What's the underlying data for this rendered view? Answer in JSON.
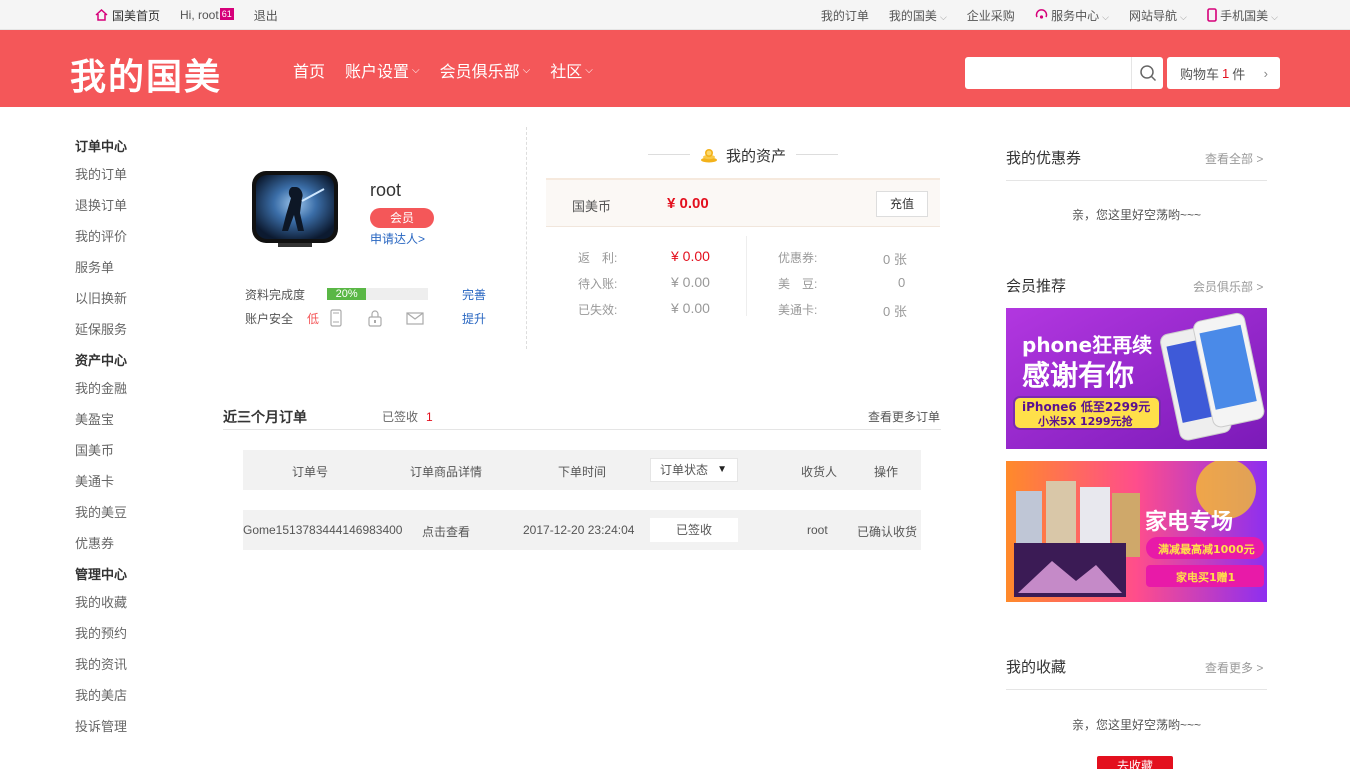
{
  "topbar": {
    "home": "国美首页",
    "greeting": "Hi, root",
    "tag": "61",
    "logout": "退出",
    "links": [
      "我的订单",
      "我的国美",
      "企业采购",
      "服务中心",
      "网站导航",
      "手机国美"
    ]
  },
  "header": {
    "logo": "我的国美",
    "nav": [
      "首页",
      "账户设置",
      "会员俱乐部",
      "社区"
    ],
    "search_placeholder": "",
    "cart_label": "购物车",
    "cart_count": "1",
    "cart_unit": "件"
  },
  "sidebar": {
    "groups": [
      {
        "title": "订单中心",
        "items": [
          "我的订单",
          "退换订单",
          "我的评价",
          "服务单",
          "以旧换新",
          "延保服务"
        ]
      },
      {
        "title": "资产中心",
        "items": [
          "我的金融",
          "美盈宝",
          "国美币",
          "美通卡",
          "我的美豆",
          "优惠券"
        ]
      },
      {
        "title": "管理中心",
        "items": [
          "我的收藏",
          "我的预约",
          "我的资讯",
          "我的美店",
          "投诉管理"
        ]
      }
    ]
  },
  "profile": {
    "username": "root",
    "badge": "会员",
    "apply": "申请达人>",
    "completion_label": "资料完成度",
    "completion_value": "20%",
    "completion_fraction": 0.2,
    "completion_action": "完善",
    "security_label": "账户安全",
    "security_level": "低",
    "security_action": "提升"
  },
  "assets": {
    "title": "我的资产",
    "coin_label": "国美币",
    "coin_value": "¥ 0.00",
    "recharge": "充值",
    "rows": [
      {
        "label": "返　利:",
        "value": "¥ 0.00"
      },
      {
        "label": "待入账:",
        "value": "¥ 0.00"
      },
      {
        "label": "已失效:",
        "value": "¥ 0.00"
      }
    ],
    "rows2": [
      {
        "label": "优惠券:",
        "value": "0 张"
      },
      {
        "label": "美　豆:",
        "value": "0"
      },
      {
        "label": "美通卡:",
        "value": "0 张"
      }
    ]
  },
  "orders": {
    "title": "近三个月订单",
    "received_label": "已签收",
    "received_count": "1",
    "more": "查看更多订单",
    "headers": [
      "订单号",
      "订单商品详情",
      "下单时间",
      "订单状态",
      "收货人",
      "操作"
    ],
    "row": {
      "id": "Gome1513783444146983400",
      "detail": "点击查看",
      "time": "2017-12-20 23:24:04",
      "status": "已签收",
      "receiver": "root",
      "action": "已确认收货"
    }
  },
  "right": {
    "coupon_title": "我的优惠券",
    "coupon_more": "查看全部 >",
    "coupon_empty": "亲，您这里好空荡哟~~~",
    "member_title": "会员推荐",
    "member_more": "会员俱乐部 >",
    "banner1": {
      "line1": "phone狂再续",
      "line2": "感谢有你",
      "line3": "iPhone6 低至2299元",
      "line4": "小米5X 1299元抢"
    },
    "banner2": {
      "line1": "家电专场",
      "line2": "满减最高减1000元",
      "line3": "家电买1赠1"
    },
    "fav_title": "我的收藏",
    "fav_more": "查看更多 >",
    "fav_empty": "亲，您这里好空荡哟~~~",
    "fav_button": "去收藏"
  },
  "colors": {
    "brand": "#f45759",
    "price": "#e3101e",
    "link": "#2866c1",
    "progress": "#5ab746"
  }
}
